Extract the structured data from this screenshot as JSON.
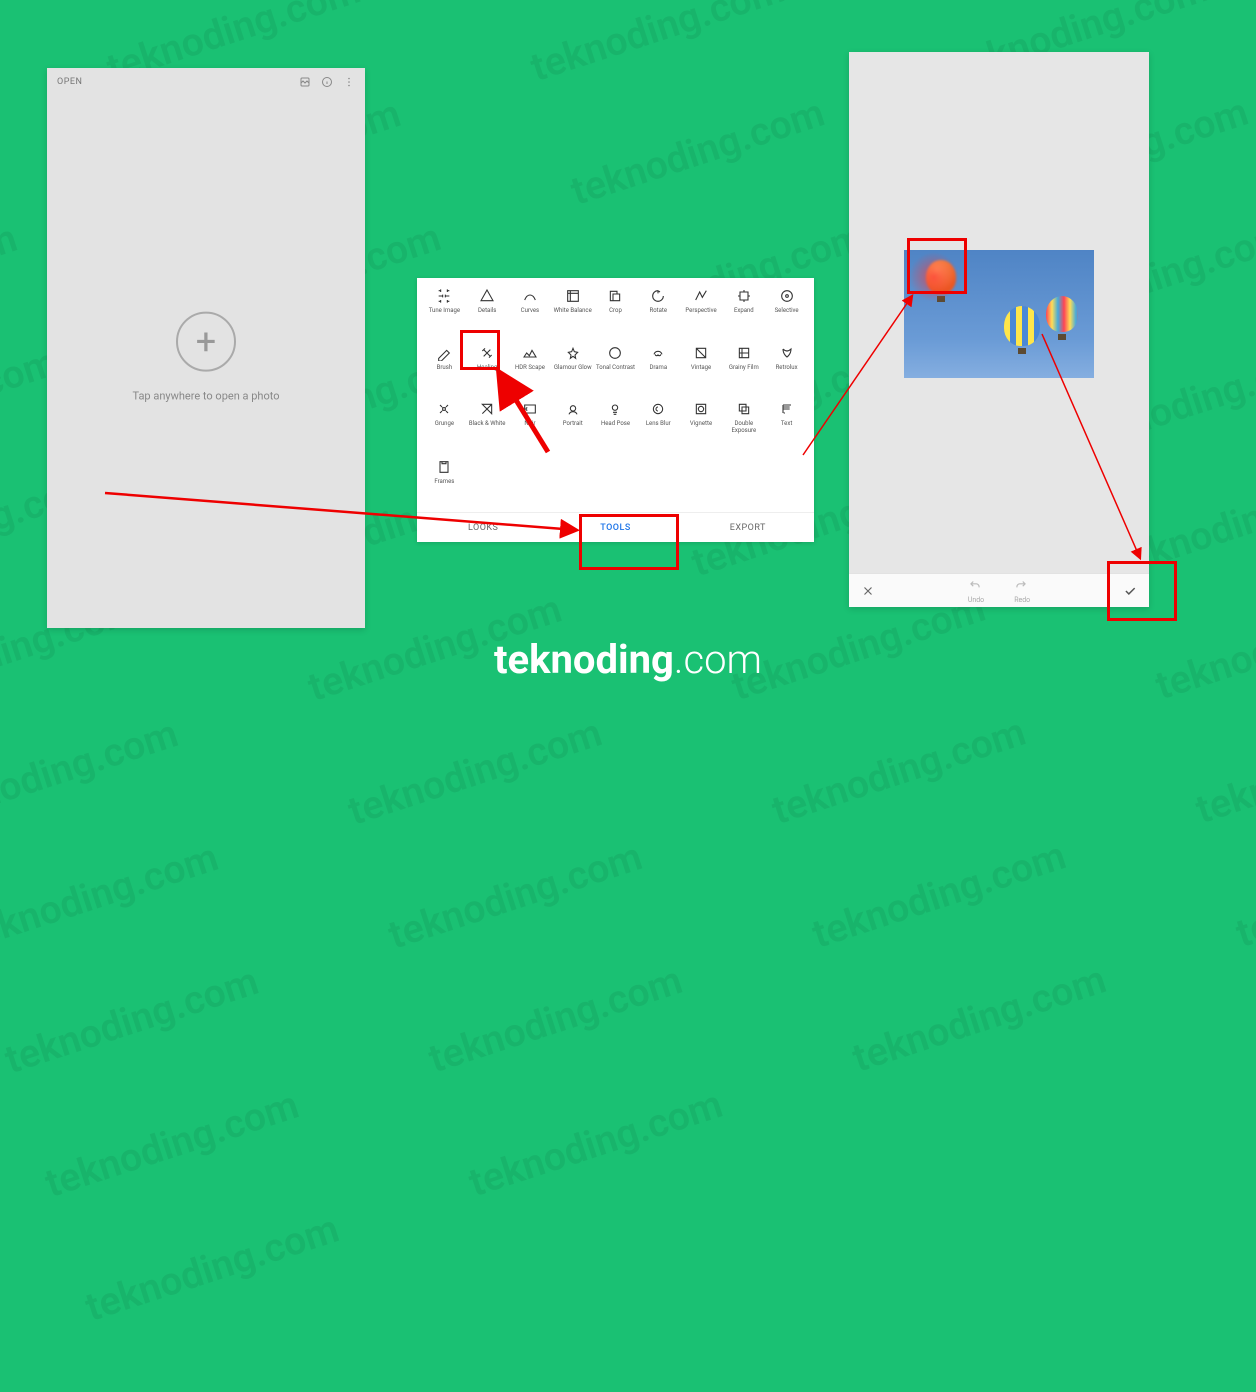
{
  "watermark_text": "teknoding.com",
  "brand": {
    "bold": "teknoding",
    "rest": ".com"
  },
  "phone1": {
    "open_label": "OPEN",
    "hint": "Tap anywhere to open a photo"
  },
  "tools_panel": {
    "tabs": {
      "looks": "LOOKS",
      "tools": "TOOLS",
      "export": "EXPORT"
    },
    "tools": [
      {
        "name": "Tune Image"
      },
      {
        "name": "Details"
      },
      {
        "name": "Curves"
      },
      {
        "name": "White Balance"
      },
      {
        "name": "Crop"
      },
      {
        "name": "Rotate"
      },
      {
        "name": "Perspective"
      },
      {
        "name": "Expand"
      },
      {
        "name": "Selective"
      },
      {
        "name": "Brush"
      },
      {
        "name": "Healing"
      },
      {
        "name": "HDR Scape"
      },
      {
        "name": "Glamour Glow"
      },
      {
        "name": "Tonal Contrast"
      },
      {
        "name": "Drama"
      },
      {
        "name": "Vintage"
      },
      {
        "name": "Grainy Film"
      },
      {
        "name": "Retrolux"
      },
      {
        "name": "Grunge"
      },
      {
        "name": "Black & White"
      },
      {
        "name": "Noir"
      },
      {
        "name": "Portrait"
      },
      {
        "name": "Head Pose"
      },
      {
        "name": "Lens Blur"
      },
      {
        "name": "Vignette"
      },
      {
        "name": "Double Exposure"
      },
      {
        "name": "Text"
      },
      {
        "name": "Frames"
      }
    ]
  },
  "phone3": {
    "undo": "Undo",
    "redo": "Redo"
  }
}
